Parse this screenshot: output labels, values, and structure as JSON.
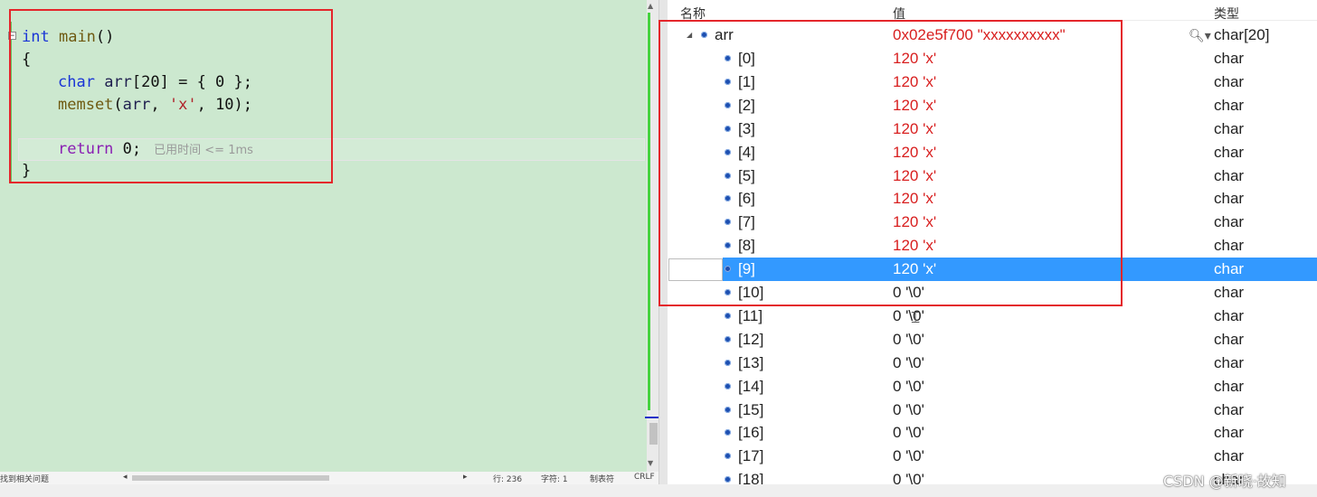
{
  "editor": {
    "lines": {
      "l1_kw": "int",
      "l1_fn": "main",
      "l1_rest": "()",
      "l2": "{",
      "l3_kw": "char",
      "l3_var": "arr",
      "l3_rest": "[20] = { 0 };",
      "l4_fn": "memset",
      "l4_a": "(",
      "l4_var": "arr",
      "l4_b": ", ",
      "l4_str": "'x'",
      "l4_c": ", 10);",
      "l6_kw": "return",
      "l6_rest": " 0;",
      "l7": "}"
    },
    "elapsed": "已用时间 <= 1ms",
    "fold_glyph": "−"
  },
  "status": {
    "issues": "找到相关问题",
    "line": "行: 236",
    "char": "字符: 1",
    "tabs": "制表符",
    "eol": "CRLF"
  },
  "watch": {
    "headers": {
      "name": "名称",
      "value": "值",
      "type": "类型"
    },
    "root": {
      "name": "arr",
      "value": "0x02e5f700 \"xxxxxxxxxx\"",
      "type": "char[20]"
    },
    "items": [
      {
        "name": "[0]",
        "value": "120 'x'",
        "type": "char",
        "changed": true
      },
      {
        "name": "[1]",
        "value": "120 'x'",
        "type": "char",
        "changed": true
      },
      {
        "name": "[2]",
        "value": "120 'x'",
        "type": "char",
        "changed": true
      },
      {
        "name": "[3]",
        "value": "120 'x'",
        "type": "char",
        "changed": true
      },
      {
        "name": "[4]",
        "value": "120 'x'",
        "type": "char",
        "changed": true
      },
      {
        "name": "[5]",
        "value": "120 'x'",
        "type": "char",
        "changed": true
      },
      {
        "name": "[6]",
        "value": "120 'x'",
        "type": "char",
        "changed": true
      },
      {
        "name": "[7]",
        "value": "120 'x'",
        "type": "char",
        "changed": true
      },
      {
        "name": "[8]",
        "value": "120 'x'",
        "type": "char",
        "changed": true
      },
      {
        "name": "[9]",
        "value": "120 'x'",
        "type": "char",
        "changed": true,
        "selected": true
      },
      {
        "name": "[10]",
        "value": "0 '\\0'",
        "type": "char",
        "changed": false
      },
      {
        "name": "[11]",
        "value": "0 '\\0'",
        "type": "char",
        "changed": false
      },
      {
        "name": "[12]",
        "value": "0 '\\0'",
        "type": "char",
        "changed": false
      },
      {
        "name": "[13]",
        "value": "0 '\\0'",
        "type": "char",
        "changed": false
      },
      {
        "name": "[14]",
        "value": "0 '\\0'",
        "type": "char",
        "changed": false
      },
      {
        "name": "[15]",
        "value": "0 '\\0'",
        "type": "char",
        "changed": false
      },
      {
        "name": "[16]",
        "value": "0 '\\0'",
        "type": "char",
        "changed": false
      },
      {
        "name": "[17]",
        "value": "0 '\\0'",
        "type": "char",
        "changed": false
      },
      {
        "name": "[18]",
        "value": "0 '\\0'",
        "type": "char",
        "changed": false
      }
    ]
  },
  "watermark": "CSDN @新晓·故知",
  "colors": {
    "changed_value": "#d81e1e",
    "selection": "#3399ff",
    "editor_bg": "#cce8cf",
    "annotation_box": "#e4262b"
  }
}
